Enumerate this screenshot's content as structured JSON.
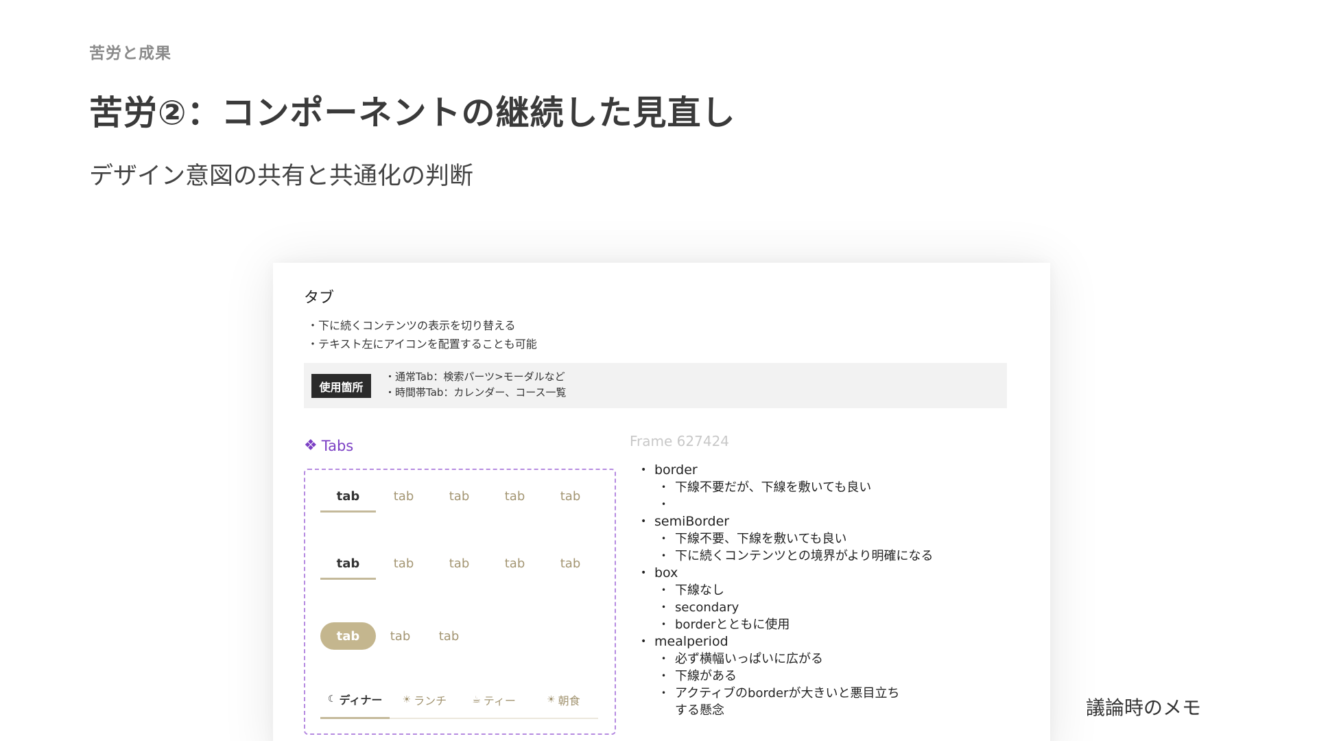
{
  "slide": {
    "eyebrow": "苦労と成果",
    "title": "苦労②：コンポーネントの継続した見直し",
    "subtitle": "デザイン意図の共有と共通化の判断",
    "memo": "議論時のメモ"
  },
  "card": {
    "title": "タブ",
    "descriptions": [
      "下に続くコンテンツの表示を切り替える",
      "テキスト左にアイコンを配置することも可能"
    ],
    "usage": {
      "badge": "使用箇所",
      "items": [
        "通常Tab：検索パーツ>モーダルなど",
        "時間帯Tab：カレンダー、コース一覧"
      ]
    },
    "component_label": "Tabs",
    "frame_label": "Frame 627424"
  },
  "tabs_demo": {
    "row1": [
      "tab",
      "tab",
      "tab",
      "tab",
      "tab"
    ],
    "row2": [
      "tab",
      "tab",
      "tab",
      "tab",
      "tab"
    ],
    "row3": [
      "tab",
      "tab",
      "tab"
    ],
    "meal": [
      {
        "label": "ディナー",
        "icon": "moon-icon",
        "glyph": "☾"
      },
      {
        "label": "ランチ",
        "icon": "sun-icon",
        "glyph": "☀"
      },
      {
        "label": "ティー",
        "icon": "cup-icon",
        "glyph": "☕"
      },
      {
        "label": "朝食",
        "icon": "sunrise-icon",
        "glyph": "☀"
      }
    ],
    "colors": {
      "accent": "#c4b68e",
      "inactive_text": "#a39572",
      "frame": "#b58ae0"
    }
  },
  "notes": {
    "border": {
      "label": "border",
      "subs": [
        "下線不要だが、下線を敷いても良い",
        ""
      ]
    },
    "semiBorder": {
      "label": "semiBorder",
      "subs": [
        "下線不要、下線を敷いても良い",
        "下に続くコンテンツとの境界がより明確になる"
      ]
    },
    "box": {
      "label": "box",
      "subs": [
        "下線なし",
        "secondary",
        "borderとともに使用"
      ]
    },
    "mealperiod": {
      "label": "mealperiod",
      "subs": [
        "必ず横幅いっぱいに広がる",
        "下線がある",
        "アクティブのborderが大きいと悪目立ち"
      ],
      "continuation": "する懸念"
    }
  }
}
